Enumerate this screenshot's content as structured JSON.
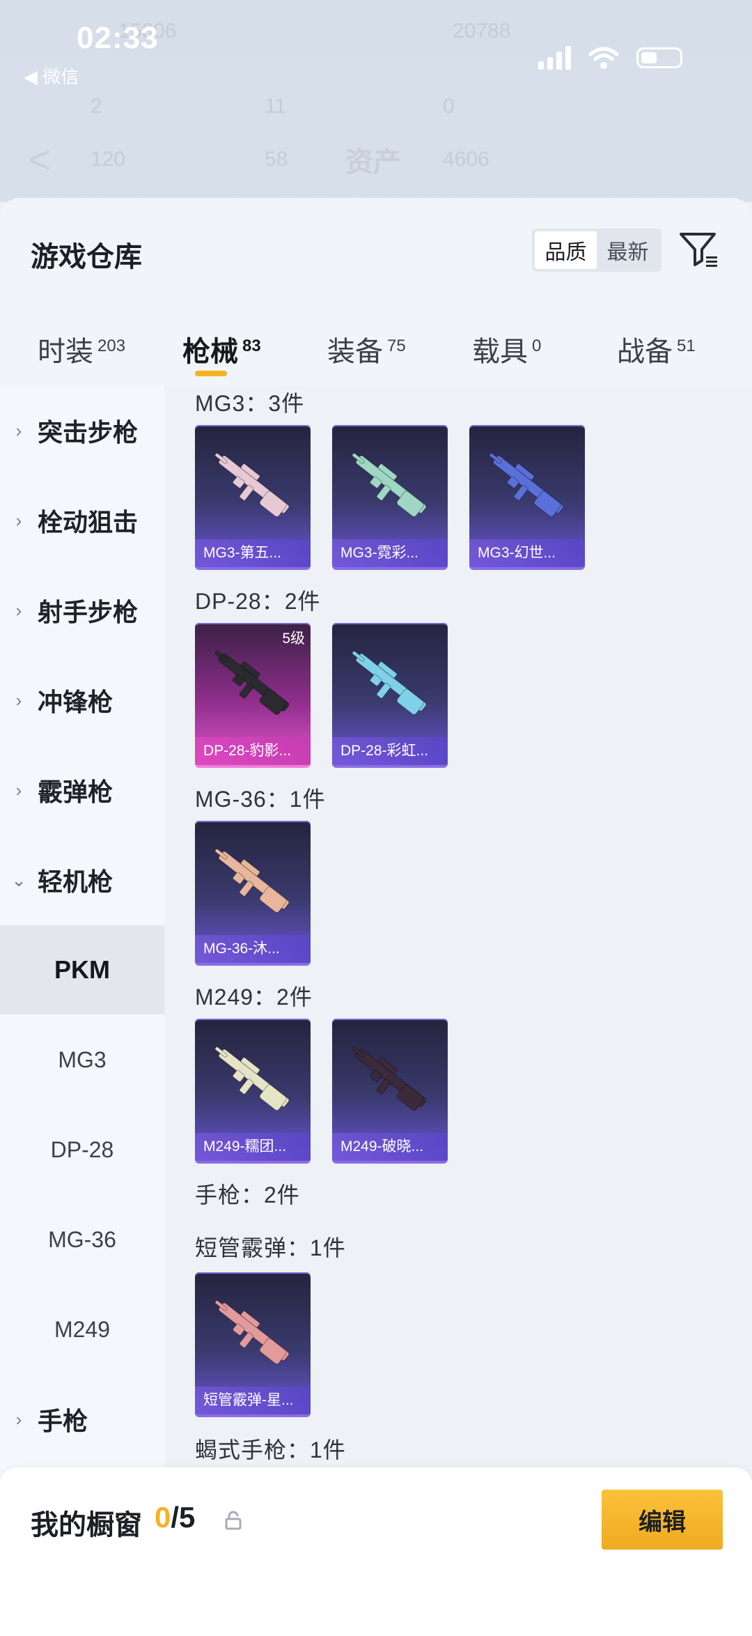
{
  "status_bar": {
    "time": "02:33",
    "back_label": "◀ 微信"
  },
  "background": {
    "title": "资产",
    "stats": [
      "15606",
      "20788",
      "2",
      "11",
      "0",
      "120",
      "58",
      "4606"
    ]
  },
  "panel": {
    "title": "游戏仓库",
    "sort": {
      "options": [
        "品质",
        "最新"
      ],
      "selected": "品质"
    },
    "tabs": [
      {
        "label": "时装",
        "count": "203"
      },
      {
        "label": "枪械",
        "count": "83",
        "active": true
      },
      {
        "label": "装备",
        "count": "75"
      },
      {
        "label": "载具",
        "count": "0"
      },
      {
        "label": "战备",
        "count": "51"
      }
    ]
  },
  "sidebar": {
    "categories": [
      "突击步枪",
      "栓动狙击",
      "射手步枪",
      "冲锋枪",
      "霰弹枪",
      "轻机枪"
    ],
    "subitems": [
      "PKM",
      "MG3",
      "DP-28",
      "MG-36",
      "M249"
    ],
    "after": "手枪",
    "selected_sub": "PKM"
  },
  "groups": [
    {
      "title": "MG3：3件",
      "items": [
        {
          "label": "MG3-第五...",
          "rarity": "purple",
          "color": "#e7c9d6"
        },
        {
          "label": "MG3-霓彩...",
          "rarity": "purple",
          "color": "#9fd6c4"
        },
        {
          "label": "MG3-幻世...",
          "rarity": "purple",
          "color": "#5a6fd8"
        }
      ]
    },
    {
      "title": "DP-28：2件",
      "items": [
        {
          "label": "DP-28-豹影...",
          "rarity": "pink",
          "level": "5级",
          "color": "#2b2b2f"
        },
        {
          "label": "DP-28-彩虹...",
          "rarity": "purple",
          "color": "#7fd0e8"
        }
      ]
    },
    {
      "title": "MG-36：1件",
      "items": [
        {
          "label": "MG-36-沐...",
          "rarity": "purple",
          "color": "#e8b69c"
        }
      ]
    },
    {
      "title": "M249：2件",
      "items": [
        {
          "label": "M249-糯团...",
          "rarity": "purple",
          "color": "#e6e4c6"
        },
        {
          "label": "M249-破晓...",
          "rarity": "purple",
          "color": "#3a2a3a"
        }
      ]
    },
    {
      "title": "手枪：2件",
      "items": []
    },
    {
      "title": "短管霰弹：1件",
      "items": [
        {
          "label": "短管霰弹-星...",
          "rarity": "purple",
          "color": "#e39a9a"
        }
      ]
    },
    {
      "title": "蝎式手枪：1件",
      "items": []
    }
  ],
  "showcase": {
    "title": "我的橱窗",
    "current": "0",
    "total": "/5",
    "edit_label": "编辑"
  },
  "colors": {
    "accent": "#f5b223",
    "card_purple": "#6a55d4",
    "card_pink": "#e055c8"
  }
}
